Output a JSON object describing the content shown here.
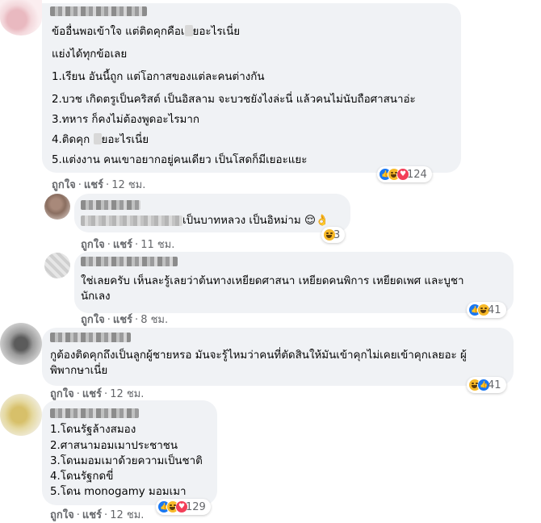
{
  "comments": [
    {
      "lines": [
        "ข้ออื่นพอเข้าใจ แต่ติดคุกคือเ",
        "ยอะไรเนี่ย",
        "แย่งได้ทุกข้อเลย",
        "1.เรียน อันนี้ถูก แต่โอกาสของแต่ละคนต่างกัน",
        "2.บวช เกิดตรูเป็นคริสต์ เป็นอิสลาม จะบวชยังไงล่ะนี่ แล้วคนไม่นับถือศาสนาอ่ะ",
        "3.ทหาร ก็คงไม่ต้องพูดอะไรมาก",
        "4.ติดคุก ",
        "ยอะไรเนี่ย",
        "5.แต่งงาน คนเขาอยากอยู่คนเดียว เป็นโสดก็มีเยอะแยะ"
      ],
      "actions": {
        "like": "ถูกใจ",
        "reply": "แชร์",
        "sep": "·",
        "time": "12 ชม."
      },
      "reactions": {
        "count": "124",
        "icons": [
          "like-icon",
          "haha-icon",
          "love-icon"
        ]
      }
    },
    {
      "lines": [
        "เป็นบาทหลวง เป็นอิหม่าม 😌👌"
      ],
      "actions": {
        "like": "ถูกใจ",
        "reply": "แชร์",
        "sep": "·",
        "time": "11 ชม."
      },
      "reactions": {
        "count": "3",
        "icons": [
          "haha-icon"
        ]
      }
    },
    {
      "lines": [
        "ใช่เลยครับ เห็นละรู้เลยว่าต้นทางเหยียดศาสนา เหยียดคนพิการ เหยียดเพศ และบูชา",
        "นักเลง"
      ],
      "actions": {
        "like": "ถูกใจ",
        "reply": "แชร์",
        "sep": "·",
        "time": "8 ชม."
      },
      "reactions": {
        "count": "41",
        "icons": [
          "like-icon",
          "haha-icon"
        ]
      }
    },
    {
      "lines": [
        "กูต้องติดคุกถึงเป็นลูกผู้ชายหรอ มันจะรู้ไหมว่าคนที่ตัดสินให้มันเข้าคุกไม่เคยเข้าคุกเลยอะ ผู้",
        "พิพากษาเนี่ย"
      ],
      "actions": {
        "like": "ถูกใจ",
        "reply": "แชร์",
        "sep": "·",
        "time": "12 ชม."
      },
      "reactions": {
        "count": "41",
        "icons": [
          "haha-icon",
          "like-icon"
        ]
      }
    },
    {
      "lines": [
        "1.โดนรัฐล้างสมอง",
        "2.ศาสนามอมเมาประชาชน",
        "3.โดนมอมเมาด้วยความเป็นชาติ",
        "4.โดนรัฐกดขี่",
        "5.โดน monogamy มอมเมา"
      ],
      "actions": {
        "like": "ถูกใจ",
        "reply": "แชร์",
        "sep": "·",
        "time": "12 ชม."
      },
      "reactions": {
        "count": "129",
        "icons": [
          "like-icon",
          "haha-icon",
          "love-icon"
        ]
      }
    }
  ],
  "colors": {
    "bubble": "#f0f2f5",
    "meta": "#65676b",
    "like": "#1877f2",
    "haha": "#f7b928",
    "love": "#f33e58"
  }
}
